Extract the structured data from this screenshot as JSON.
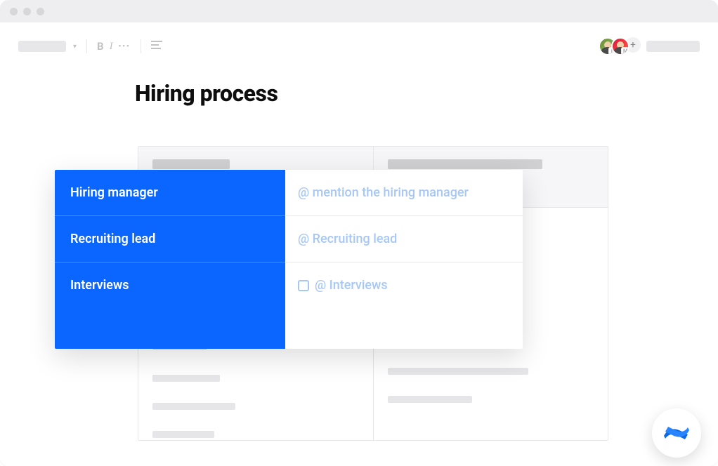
{
  "page": {
    "title": "Hiring process"
  },
  "toolbar": {
    "bold": "B",
    "italic": "I",
    "more": "•••"
  },
  "avatars": {
    "badge1": "R",
    "badge2": "M",
    "add": "+"
  },
  "overlay": {
    "rows": [
      {
        "label": "Hiring manager",
        "placeholder": "@ mention the hiring manager"
      },
      {
        "label": "Recruiting lead",
        "placeholder": "@ Recruiting lead"
      },
      {
        "label": "Interviews",
        "placeholder": "@ Interviews",
        "checkbox": true
      }
    ]
  },
  "colors": {
    "primary": "#0b66ff",
    "placeholder": "#a8c8f4"
  }
}
